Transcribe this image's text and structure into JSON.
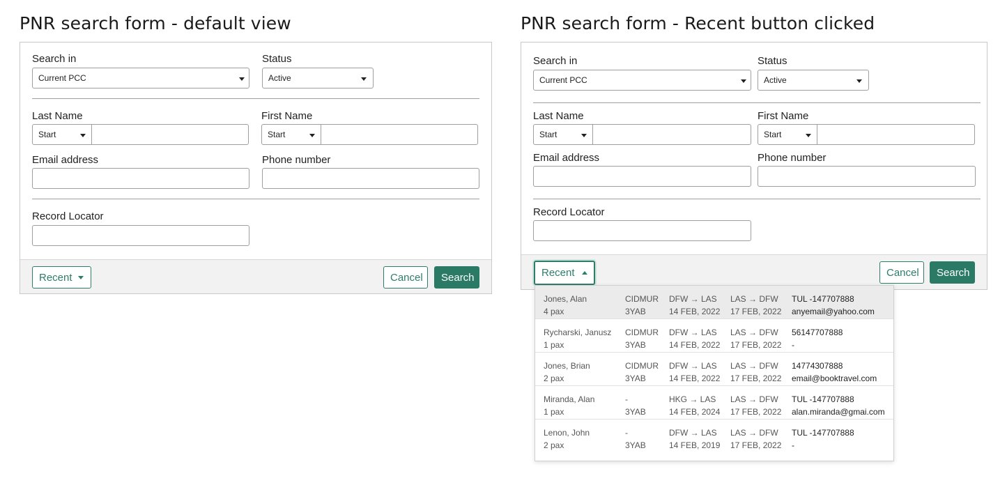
{
  "left": {
    "heading": "PNR search form - default view",
    "search_in_label": "Search in",
    "search_in_value": "Current PCC",
    "status_label": "Status",
    "status_value": "Active",
    "last_name_label": "Last Name",
    "last_name_mode": "Start",
    "last_name_value": "",
    "first_name_label": "First Name",
    "first_name_mode": "Start",
    "first_name_value": "",
    "email_label": "Email address",
    "email_value": "",
    "phone_label": "Phone number",
    "phone_value": "",
    "record_locator_label": "Record Locator",
    "record_locator_value": "",
    "recent_label": "Recent",
    "cancel_label": "Cancel",
    "search_label": "Search"
  },
  "right": {
    "heading": "PNR search form - Recent button clicked",
    "search_in_label": "Search in",
    "search_in_value": "Current PCC",
    "status_label": "Status",
    "status_value": "Active",
    "last_name_label": "Last Name",
    "last_name_mode": "Start",
    "last_name_value": "",
    "first_name_label": "First Name",
    "first_name_mode": "Start",
    "first_name_value": "",
    "email_label": "Email address",
    "email_value": "",
    "phone_label": "Phone number",
    "phone_value": "",
    "record_locator_label": "Record Locator",
    "record_locator_value": "",
    "recent_label": "Recent",
    "cancel_label": "Cancel",
    "search_label": "Search",
    "recent_items": [
      {
        "name": "Jones, Alan",
        "pax": "4 pax",
        "code1": "CIDMUR",
        "code2": "3YAB",
        "out_route": "DFW → LAS",
        "out_date": "14 FEB, 2022",
        "ret_route": "LAS → DFW",
        "ret_date": "17 FEB, 2022",
        "phone": "TUL -147707888",
        "email": "anyemail@yahoo.com"
      },
      {
        "name": "Rycharski, Janusz",
        "pax": "1 pax",
        "code1": "CIDMUR",
        "code2": "3YAB",
        "out_route": "DFW → LAS",
        "out_date": "14 FEB, 2022",
        "ret_route": "LAS → DFW",
        "ret_date": "17 FEB, 2022",
        "phone": "56147707888",
        "email": "-"
      },
      {
        "name": "Jones, Brian",
        "pax": "2 pax",
        "code1": "CIDMUR",
        "code2": "3YAB",
        "out_route": "DFW → LAS",
        "out_date": "14 FEB, 2022",
        "ret_route": "LAS → DFW",
        "ret_date": "17 FEB, 2022",
        "phone": "14774307888",
        "email": "email@booktravel.com"
      },
      {
        "name": "Miranda, Alan",
        "pax": "1 pax",
        "code1": "-",
        "code2": "3YAB",
        "out_route": "HKG → LAS",
        "out_date": "14 FEB, 2024",
        "ret_route": "LAS → DFW",
        "ret_date": "17 FEB, 2022",
        "phone": "TUL -147707888",
        "email": "alan.miranda@gmai.com"
      },
      {
        "name": "Lenon, John",
        "pax": "2 pax",
        "code1": "-",
        "code2": "3YAB",
        "out_route": "DFW → LAS",
        "out_date": "14 FEB, 2019",
        "ret_route": "LAS → DFW",
        "ret_date": "17 FEB, 2022",
        "phone": "TUL -147707888",
        "email": "-"
      }
    ]
  },
  "colors": {
    "accent": "#2b7a66",
    "footer_bg": "#f2f2f2",
    "row_highlight": "#ebebeb"
  },
  "icons": [
    "chevron-down-icon",
    "chevron-up-icon"
  ]
}
